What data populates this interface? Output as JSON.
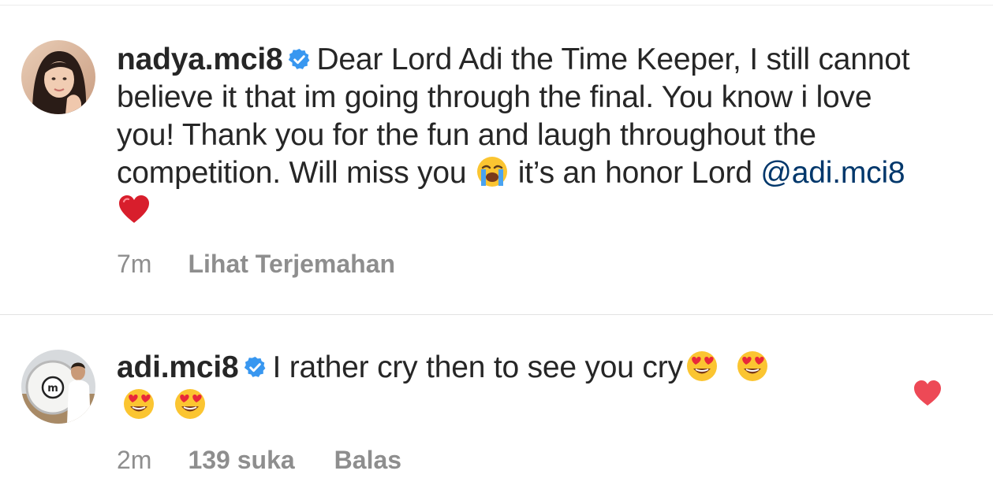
{
  "comments": [
    {
      "username": "nadya.mci8",
      "text_parts": [
        "Dear Lord Adi the Time Keeper, I still cannot believe it that im going through the final. You know i love you! Thank you for the fun and laugh throughout the competition. Will miss you",
        "it’s an honor Lord"
      ],
      "mention": "@adi.mci8",
      "emojis": [
        "loudly-crying-face",
        "red-heart"
      ],
      "time": "7m",
      "translate_label": "Lihat Terjemahan"
    },
    {
      "username": "adi.mci8",
      "text": "I rather cry then to see you cry",
      "emojis": [
        "heart-eyes-face",
        "heart-eyes-face",
        "heart-eyes-face",
        "heart-eyes-face"
      ],
      "time": "2m",
      "likes": "139 suka",
      "reply_label": "Balas",
      "liked": true
    }
  ],
  "colors": {
    "text": "#262626",
    "meta": "#8e8e8e",
    "mention": "#00376b",
    "verified": "#3897f0",
    "like": "#ed4956"
  }
}
